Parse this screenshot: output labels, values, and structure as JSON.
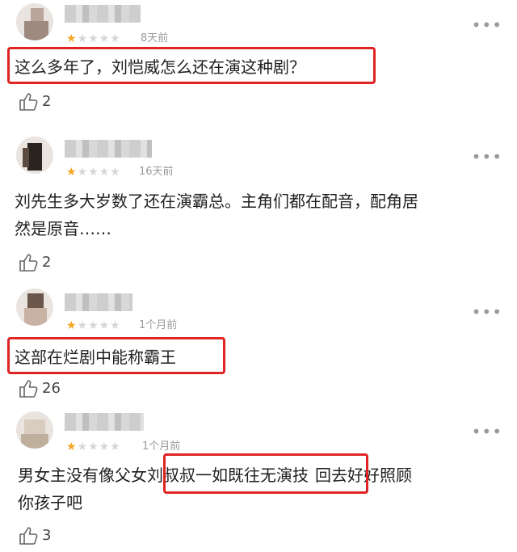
{
  "comments": [
    {
      "time": "8天前",
      "text_lines": [
        "这么多年了，刘恺威怎么还在演这种剧？"
      ],
      "likes": "2",
      "rating": 1,
      "more_icon": "more-dots-icon",
      "like_icon": "thumbs-up-icon"
    },
    {
      "time": "16天前",
      "text_lines": [
        "刘先生多大岁数了还在演霸总。主角们都在配音，配角居",
        "然是原音……"
      ],
      "likes": "2",
      "rating": 1
    },
    {
      "time": "1个月前",
      "text_lines": [
        "这部在烂剧中能称霸王"
      ],
      "likes": "26",
      "rating": 1
    },
    {
      "time": "1个月前",
      "text_lead": "男女主没有像父女",
      "text_highlight": "刘叔叔一如既往无演技",
      "text_tail": "回去好好照顾",
      "text_line2": "你孩子吧",
      "likes": "3",
      "rating": 1
    }
  ],
  "colors": {
    "highlight_box": "#e02424",
    "star_on": "#f6a623",
    "star_off": "#d6d6d6",
    "meta_text": "#9a9a9a"
  }
}
